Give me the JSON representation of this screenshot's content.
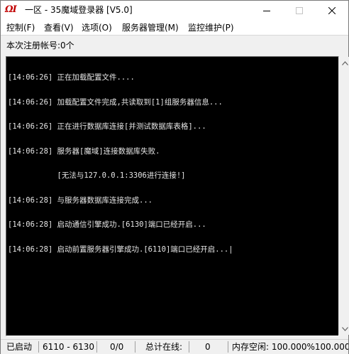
{
  "window": {
    "icon_text": "ΩI",
    "title": "一区 - 35魔域登录器 [V5.0]"
  },
  "menu": [
    {
      "label": "控制(F)"
    },
    {
      "label": "查看(V)"
    },
    {
      "label": "选项(O)"
    },
    {
      "label": "服务器管理(M)"
    },
    {
      "label": "监控维护(P)"
    }
  ],
  "registration": {
    "label": "本次注册帐号:0个"
  },
  "log": [
    "[14:06:26] 正在加载配置文件....",
    "[14:06:26] 加载配置文件完成,共读取到[1]组服务器信息...",
    "[14:06:26] 正在进行数据库连接[并测试数据库表格]...",
    "[14:06:28] 服务器[魔域]连接数据库失败.",
    "           [无法与127.0.0.1:3306进行连接!]",
    "[14:06:28] 与服务器数据库连接完成...",
    "[14:06:28] 启动通信引擎成功.[6130]端口已经开启...",
    "[14:06:28] 启动前置服务器引擎成功.[6110]端口已经开启...|"
  ],
  "status": {
    "state": "已启动",
    "ports": "6110 - 6130",
    "count": "0/0",
    "online_label": "总计在线:",
    "online_value": "0",
    "memory": "内存空闲: 100.000%100.000%"
  },
  "colors": {
    "console_bg": "#000000",
    "console_text": "#e6e6e6",
    "icon_red": "#c00000"
  }
}
